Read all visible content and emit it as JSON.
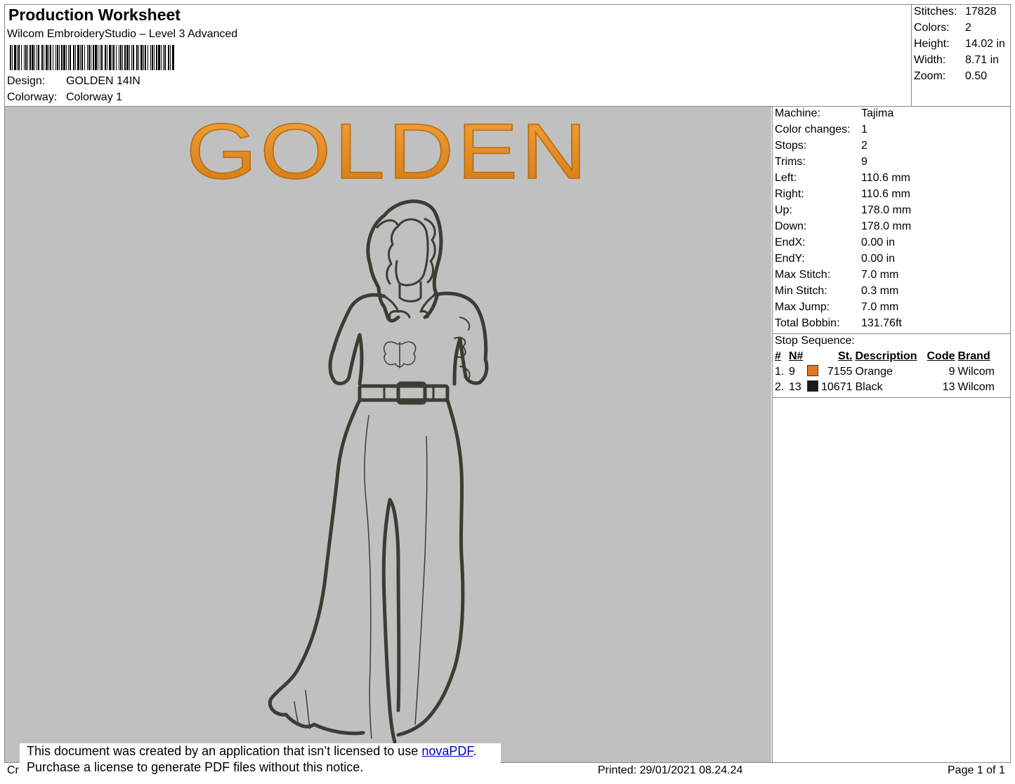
{
  "header": {
    "title": "Production Worksheet",
    "subtitle": "Wilcom EmbroideryStudio – Level 3 Advanced",
    "design_label": "Design:",
    "design_value": "GOLDEN 14IN",
    "colorway_label": "Colorway:",
    "colorway_value": "Colorway 1"
  },
  "summary": [
    {
      "label": "Stitches:",
      "value": "17828"
    },
    {
      "label": "Colors:",
      "value": "2"
    },
    {
      "label": "Height:",
      "value": "14.02 in"
    },
    {
      "label": "Width:",
      "value": "8.71 in"
    },
    {
      "label": "Zoom:",
      "value": "0.50"
    }
  ],
  "machine_info": [
    {
      "label": "Machine:",
      "value": "Tajima"
    },
    {
      "label": "Color changes:",
      "value": "1"
    },
    {
      "label": "Stops:",
      "value": "2"
    },
    {
      "label": "Trims:",
      "value": "9"
    },
    {
      "label": "Left:",
      "value": "110.6 mm"
    },
    {
      "label": "Right:",
      "value": "110.6 mm"
    },
    {
      "label": "Up:",
      "value": "178.0 mm"
    },
    {
      "label": "Down:",
      "value": "178.0 mm"
    },
    {
      "label": "EndX:",
      "value": "0.00 in"
    },
    {
      "label": "EndY:",
      "value": "0.00 in"
    },
    {
      "label": "Max Stitch:",
      "value": "7.0 mm"
    },
    {
      "label": "Min Stitch:",
      "value": "0.3 mm"
    },
    {
      "label": "Max Jump:",
      "value": "7.0 mm"
    },
    {
      "label": "Total Bobbin:",
      "value": "131.76ft"
    }
  ],
  "stop_sequence": {
    "heading": "Stop Sequence:",
    "columns": [
      "#",
      "N#",
      "St.",
      "Description",
      "Code",
      "Brand"
    ],
    "rows": [
      {
        "num": "1.",
        "n": "9",
        "color": "#e8761a",
        "st": "7155",
        "description": "Orange",
        "code": "9",
        "brand": "Wilcom"
      },
      {
        "num": "2.",
        "n": "13",
        "color": "#1a1a1a",
        "st": "10671",
        "description": "Black",
        "code": "13",
        "brand": "Wilcom"
      }
    ]
  },
  "design_preview": {
    "text": "GOLDEN",
    "text_color": "#e8921e",
    "background": "#c0c0c0",
    "outline_color": "#3c3c34"
  },
  "notice": {
    "line1_prefix": "This document was created by an application that isn’t licensed to use ",
    "link_text": "novaPDF",
    "line1_suffix": ".",
    "line2": "Purchase a license to generate PDF files without this notice."
  },
  "footer": {
    "left_fragment": "Cr",
    "printed": "Printed: 29/01/2021 08.24.24",
    "page": "Page 1 of 1"
  }
}
